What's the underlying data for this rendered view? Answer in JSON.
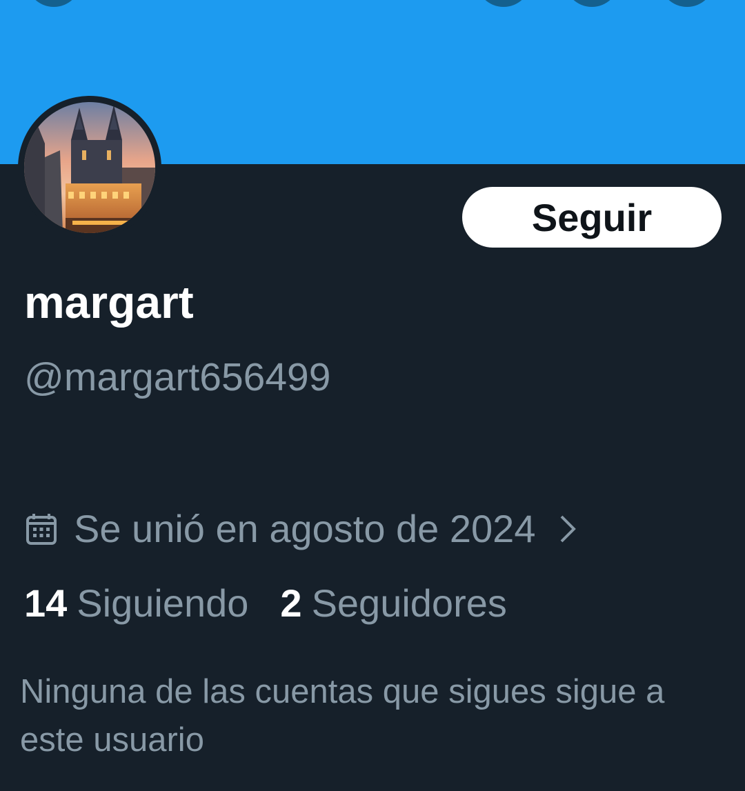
{
  "colors": {
    "banner": "#1d9bf0",
    "background": "#16202a",
    "secondary_text": "#8899a6",
    "primary_text": "#ffffff",
    "button_bg": "#ffffff",
    "button_text": "#0f1419"
  },
  "header": {
    "icons": [
      "back-icon",
      "header-action-icon",
      "header-action-icon",
      "header-action-icon"
    ]
  },
  "profile": {
    "display_name": "margart",
    "handle": "@margart656499",
    "follow_label": "Seguir",
    "joined_text": "Se unió en agosto de 2024",
    "joined_icon": "calendar-icon",
    "chevron_icon": "chevron-right-icon",
    "following_count": "14",
    "following_label": "Siguiendo",
    "followers_count": "2",
    "followers_label": "Seguidores",
    "mutuals_note": "Ninguna de las cuentas que sigues sigue a este usuario"
  }
}
